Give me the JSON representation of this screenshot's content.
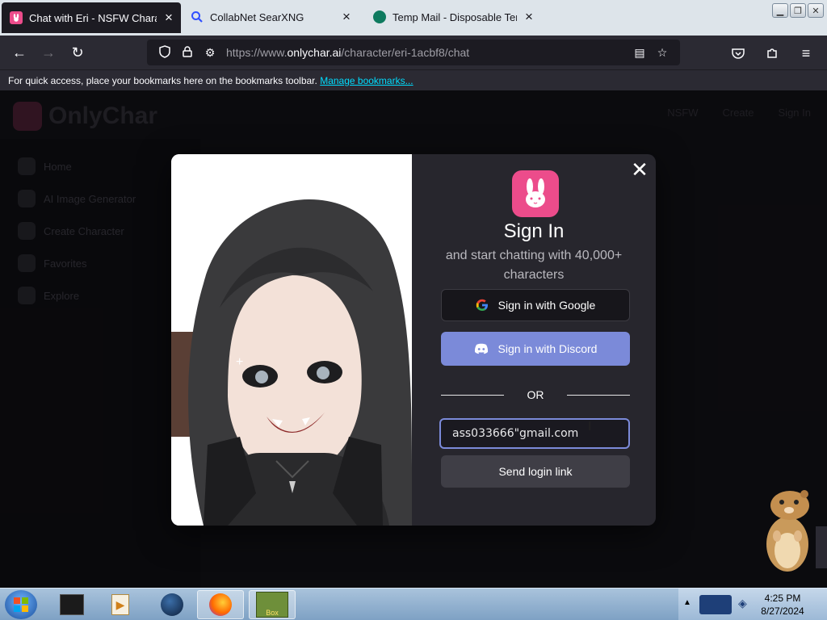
{
  "browser": {
    "tabs": [
      {
        "title": "Chat with Eri - NSFW Character",
        "active": true
      },
      {
        "title": "CollabNet SearXNG",
        "active": false
      },
      {
        "title": "Temp Mail - Disposable Tempo",
        "active": false
      }
    ],
    "url_prefix": "https://www.",
    "url_domain": "onlychar.ai",
    "url_path": "/character/eri-1acbf8/chat",
    "bookmarks_text": "For quick access, place your bookmarks here on the bookmarks toolbar.",
    "bookmarks_link": "Manage bookmarks..."
  },
  "app": {
    "brand": "OnlyChar",
    "sidebar_items": [
      "Home",
      "AI Image Generator",
      "Create Character",
      "Favorites",
      "Explore"
    ],
    "topbar_items": [
      "NSFW",
      "Create",
      "Sign In"
    ]
  },
  "modal": {
    "title": "Sign In",
    "subtitle": "and start chatting with 40,000+ characters",
    "google_label": "Sign in with Google",
    "discord_label": "Sign in with Discord",
    "or_label": "OR",
    "email_value": "ass033666\"gmail.com",
    "send_label": "Send login link",
    "accent_color": "#ec4c8b",
    "discord_color": "#7b8ad9"
  },
  "taskbar": {
    "time": "4:25 PM",
    "date": "8/27/2024",
    "box_label": "Box"
  }
}
